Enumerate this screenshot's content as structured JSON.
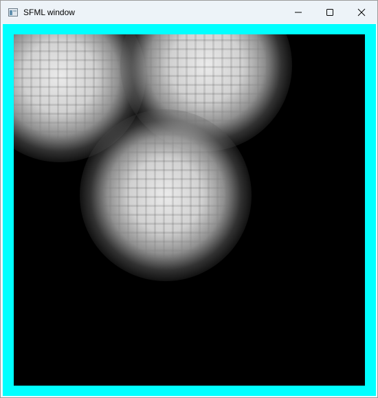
{
  "window": {
    "title": "SFML window",
    "icons": {
      "app": "app-window-icon",
      "minimize": "minimize-icon",
      "maximize": "maximize-icon",
      "close": "close-icon"
    }
  },
  "colors": {
    "titlebar": "#edf3f8",
    "frame": "#00ffff",
    "canvas": "#000000",
    "blob": "#dcdcdc"
  }
}
